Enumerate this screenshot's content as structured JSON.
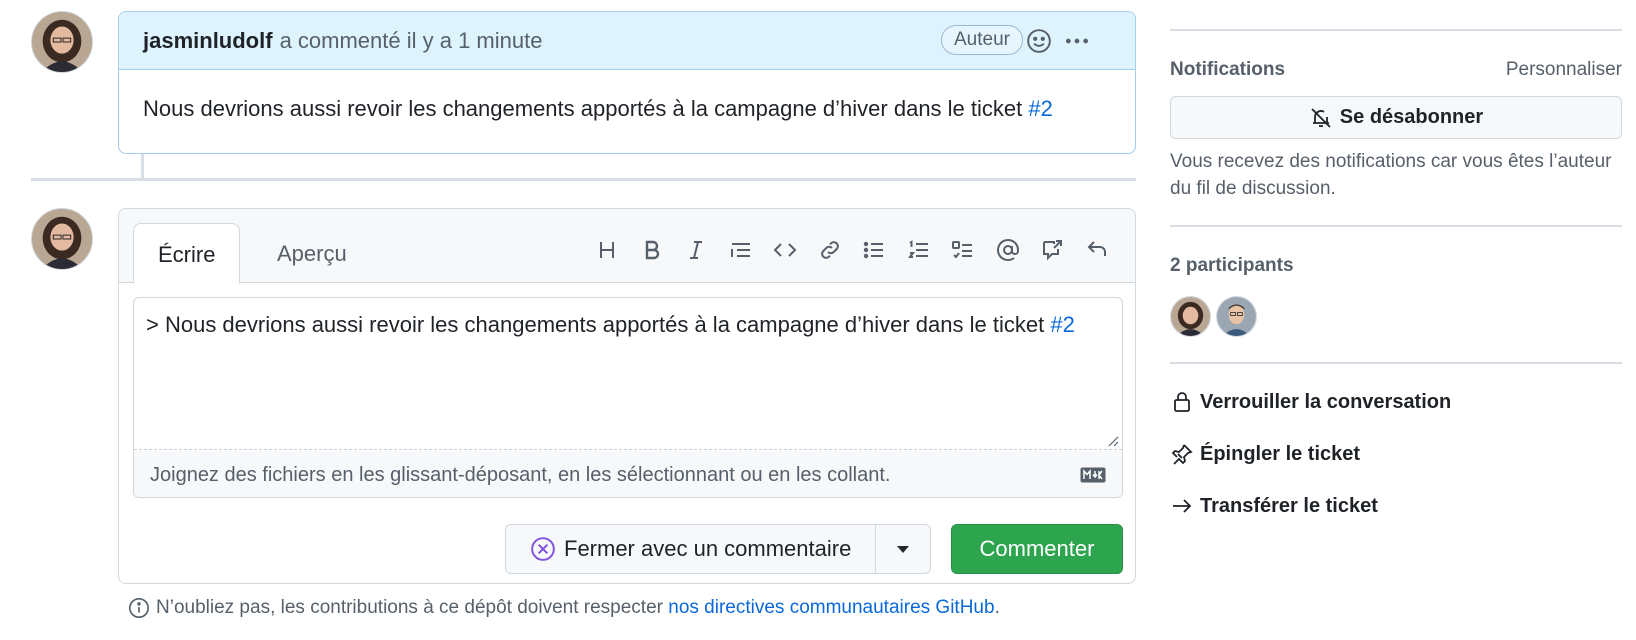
{
  "comment": {
    "author": "jasminludolf",
    "meta": "a commenté il y a 1 minute",
    "badge": "Auteur",
    "body_text": "Nous devrions aussi revoir les changements apportés à la campagne d’hiver dans le ticket ",
    "body_ref": "#2"
  },
  "editor": {
    "tab_write": "Écrire",
    "tab_preview": "Aperçu",
    "toolbar_icons": [
      "heading-icon",
      "bold-icon",
      "italic-icon",
      "quote-icon",
      "code-icon",
      "link-icon",
      "bulleted-list-icon",
      "numbered-list-icon",
      "task-list-icon",
      "mention-icon",
      "cross-reference-icon",
      "reply-icon"
    ],
    "text_prefix": "> Nous devrions aussi revoir les changements apportés à la campagne d’hiver dans le ticket ",
    "text_ref": "#2",
    "attach_hint": "Joignez des fichiers en les glissant-déposant, en les sélectionnant ou en les collant.",
    "close_label": "Fermer avec un commentaire",
    "comment_label": "Commenter"
  },
  "footer": {
    "text": "N’oubliez pas, les contributions à ce dépôt doivent respecter ",
    "link": "nos directives communautaires GitHub",
    "end": "."
  },
  "sidebar": {
    "notifications_heading": "Notifications",
    "customize_link": "Personnaliser",
    "unsubscribe_label": "Se désabonner",
    "notifications_note": "Vous recevez des notifications car vous êtes l’auteur du fil de discussion.",
    "participants_heading": "2 participants",
    "lock_label": "Verrouiller la conversation",
    "pin_label": "Épingler le ticket",
    "transfer_label": "Transférer le ticket"
  },
  "colors": {
    "accent_blue": "#0969da",
    "comment_header_bg": "#ddf4ff",
    "primary_green": "#2da44e"
  }
}
